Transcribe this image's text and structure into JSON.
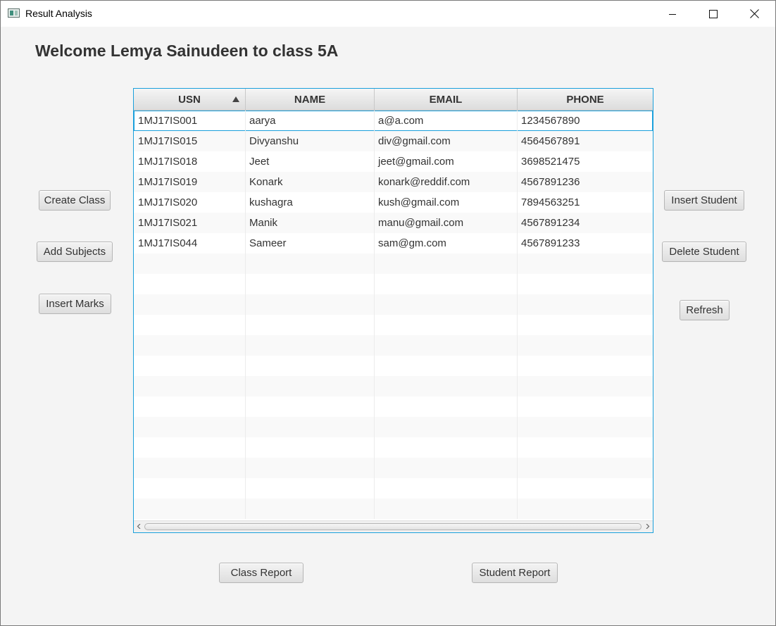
{
  "window": {
    "title": "Result Analysis"
  },
  "header": {
    "welcome": "Welcome Lemya Sainudeen to class 5A"
  },
  "left_buttons": {
    "create_class": "Create Class",
    "add_subjects": "Add Subjects",
    "insert_marks": "Insert Marks"
  },
  "right_buttons": {
    "insert_student": "Insert Student",
    "delete_student": "Delete Student",
    "refresh": "Refresh"
  },
  "bottom_buttons": {
    "class_report": "Class Report",
    "student_report": "Student Report"
  },
  "table": {
    "columns": [
      "USN",
      "NAME",
      "EMAIL",
      "PHONE"
    ],
    "sort_column": "USN",
    "sort_direction": "ascending",
    "rows": [
      [
        "1MJ17IS001",
        "aarya",
        "a@a.com",
        "1234567890"
      ],
      [
        "1MJ17IS015",
        "Divyanshu",
        "div@gmail.com",
        "4564567891"
      ],
      [
        "1MJ17IS018",
        "Jeet",
        "jeet@gmail.com",
        "3698521475"
      ],
      [
        "1MJ17IS019",
        "Konark",
        "konark@reddif.com",
        "4567891236"
      ],
      [
        "1MJ17IS020",
        "kushagra",
        "kush@gmail.com",
        "7894563251"
      ],
      [
        "1MJ17IS021",
        "Manik",
        "manu@gmail.com",
        "4567891234"
      ],
      [
        "1MJ17IS044",
        "Sameer",
        "sam@gm.com",
        "4567891233"
      ]
    ],
    "selected_row": 0
  }
}
